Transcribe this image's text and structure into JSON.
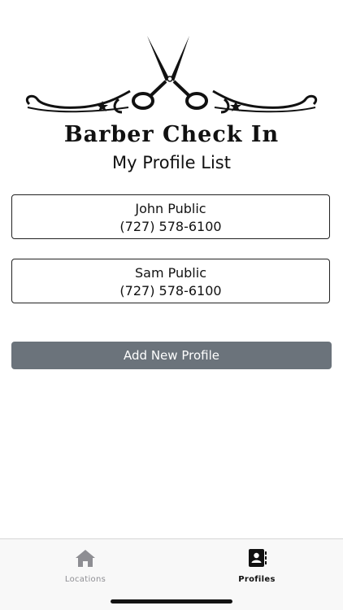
{
  "logo": {
    "text": "Barber Check In",
    "icon": "scissors-icon"
  },
  "page_title": "My Profile List",
  "profiles": [
    {
      "name": "John Public",
      "phone": "(727) 578-6100"
    },
    {
      "name": "Sam Public",
      "phone": "(727) 578-6100"
    }
  ],
  "add_button_label": "Add New Profile",
  "tabbar": {
    "tabs": [
      {
        "label": "Locations",
        "icon": "home-icon",
        "active": false
      },
      {
        "label": "Profiles",
        "icon": "contact-book-icon",
        "active": true
      }
    ]
  },
  "colors": {
    "button_bg": "#6b737b",
    "tab_inactive": "#8e8e93",
    "tab_active": "#111111",
    "border": "#222222"
  }
}
